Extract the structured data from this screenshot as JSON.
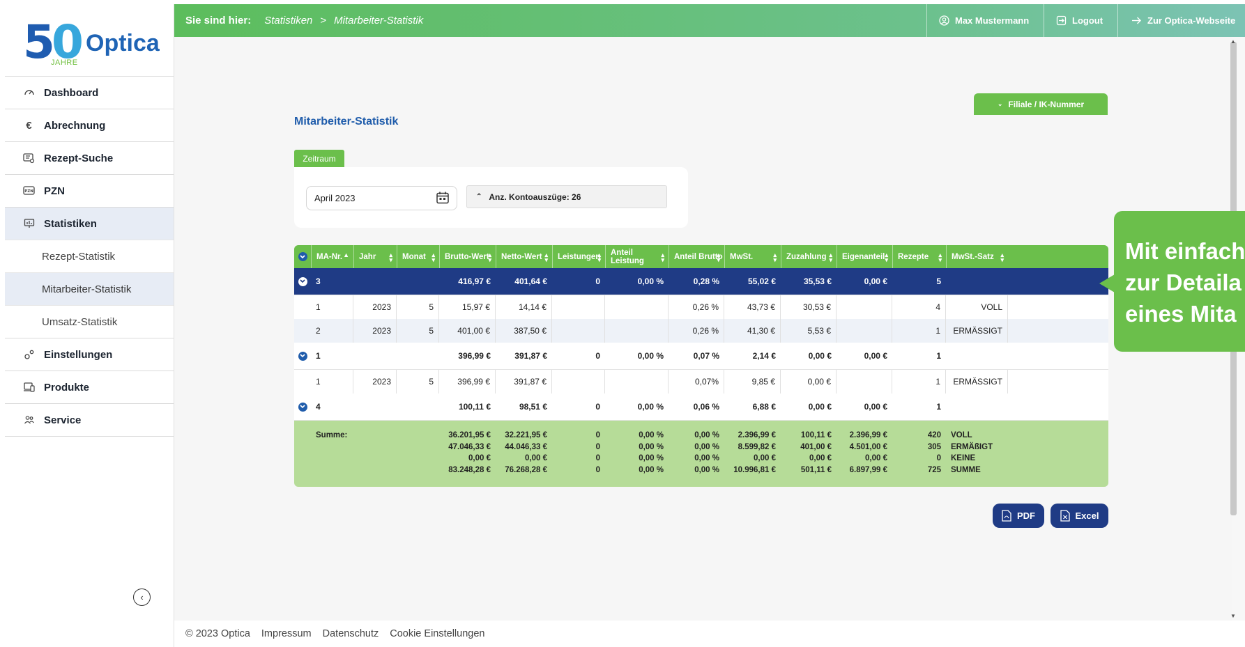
{
  "logo": {
    "number": "50",
    "jahre": "JAHRE",
    "brand": "Optica"
  },
  "sidebar": {
    "items": [
      {
        "label": "Dashboard"
      },
      {
        "label": "Abrechnung"
      },
      {
        "label": "Rezept-Suche"
      },
      {
        "label": "PZN"
      },
      {
        "label": "Statistiken"
      },
      {
        "label": "Einstellungen"
      },
      {
        "label": "Produkte"
      },
      {
        "label": "Service"
      }
    ],
    "subitems": [
      {
        "label": "Rezept-Statistik"
      },
      {
        "label": "Mitarbeiter-Statistik"
      },
      {
        "label": "Umsatz-Statistik"
      }
    ],
    "collapse_glyph": "‹"
  },
  "topbar": {
    "breadcrumb_label": "Sie sind hier:",
    "crumbs": [
      "Statistiken",
      "Mitarbeiter-Statistik"
    ],
    "separator": ">",
    "user": "Max Mustermann",
    "logout": "Logout",
    "website": "Zur Optica-Webseite"
  },
  "page": {
    "title": "Mitarbeiter-Statistik",
    "filiale_button": "Filiale / IK-Nummer",
    "zeitraum_tab": "Zeitraum",
    "date_value": "April 2023",
    "konto_label": "Anz. Kontoauszüge: 26"
  },
  "table": {
    "headers": [
      "MA-Nr.",
      "Jahr",
      "Monat",
      "Brutto-Wert",
      "Netto-Wert",
      "Leistungen",
      "Anteil Leistung",
      "Anteil Brutto",
      "MwSt.",
      "Zuzahlung",
      "Eigenanteil",
      "Rezepte",
      "MwSt.-Satz"
    ],
    "groups": [
      {
        "summary": [
          "3",
          "",
          "",
          "416,97 €",
          "401,64 €",
          "0",
          "0,00 %",
          "0,28 %",
          "55,02 €",
          "35,53 €",
          "0,00 €",
          "5",
          ""
        ],
        "rows": [
          [
            "1",
            "2023",
            "5",
            "15,97 €",
            "14,14 €",
            "",
            "",
            "0,26 %",
            "43,73 €",
            "30,53 €",
            "",
            "4",
            "VOLL"
          ],
          [
            "2",
            "2023",
            "5",
            "401,00 €",
            "387,50 €",
            "",
            "",
            "0,26 %",
            "41,30 €",
            "5,53 €",
            "",
            "1",
            "ERMÄSSIGT"
          ]
        ]
      },
      {
        "summary": [
          "1",
          "",
          "",
          "396,99 €",
          "391,87 €",
          "0",
          "0,00 %",
          "0,07 %",
          "2,14 €",
          "0,00 €",
          "0,00 €",
          "1",
          ""
        ],
        "rows": [
          [
            "1",
            "2023",
            "5",
            "396,99 €",
            "391,87 €",
            "",
            "",
            "0,07%",
            "9,85 €",
            "0,00 €",
            "",
            "1",
            "ERMÄSSIGT"
          ]
        ]
      },
      {
        "summary": [
          "4",
          "",
          "",
          "100,11 €",
          "98,51 €",
          "0",
          "0,00 %",
          "0,06 %",
          "6,88 €",
          "0,00 €",
          "0,00 €",
          "1",
          ""
        ],
        "rows": []
      }
    ],
    "summe": {
      "label": "Summe:",
      "brutto": [
        "36.201,95 €",
        "47.046,33 €",
        "0,00 €",
        "83.248,28 €"
      ],
      "netto": [
        "32.221,95 €",
        "44.046,33 €",
        "0,00 €",
        "76.268,28 €"
      ],
      "leistungen": [
        "0",
        "0",
        "0",
        "0"
      ],
      "anteil_leistung": [
        "0,00 %",
        "0,00 %",
        "0,00 %",
        "0,00 %"
      ],
      "anteil_brutto": [
        "0,00 %",
        "0,00 %",
        "0,00 %",
        "0,00 %"
      ],
      "mwst": [
        "2.396,99 €",
        "8.599,82 €",
        "0,00 €",
        "10.996,81 €"
      ],
      "zuzahlung": [
        "100,11 €",
        "401,00 €",
        "0,00 €",
        "501,11 €"
      ],
      "eigenanteil": [
        "2.396,99 €",
        "4.501,00 €",
        "0,00 €",
        "6.897,99 €"
      ],
      "rezepte": [
        "420",
        "305",
        "0",
        "725"
      ],
      "satz": [
        "VOLL",
        "ERMÄßIGT",
        "KEINE",
        "SUMME"
      ]
    }
  },
  "buttons": {
    "pdf": "PDF",
    "excel": "Excel"
  },
  "callout": {
    "lines": [
      "Mit einfach",
      "zur Detaila",
      "eines Mita"
    ]
  },
  "footer": [
    "© 2023 Optica",
    "Impressum",
    "Datenschutz",
    "Cookie Einstellungen"
  ],
  "colors": {
    "green": "#6bbf4b",
    "navy": "#1f3b85",
    "blue": "#1f5cab",
    "sum_bg": "#b6dc98"
  }
}
